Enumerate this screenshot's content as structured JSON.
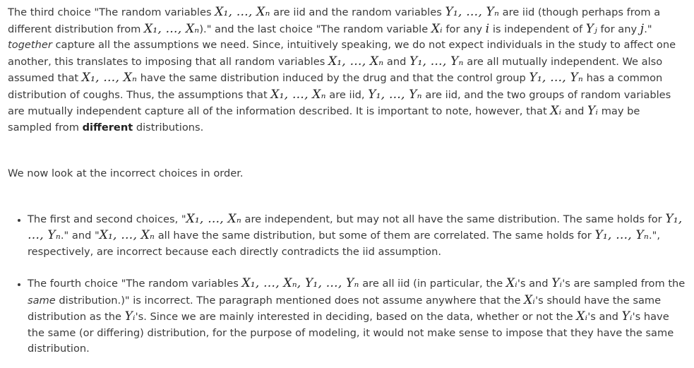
{
  "intro": {
    "p01": "The third choice \"The random variables ",
    "m01": "X₁, …, Xₙ",
    "p02": " are iid and the random variables ",
    "m02": "Y₁, …, Yₙ",
    "p03": " are iid (though perhaps from a different distribution from ",
    "m03": "X₁, …, Xₙ",
    "p04": ").\" and the last choice \"The random variable ",
    "m04": "Xᵢ",
    "p05": " for any ",
    "m05": "i",
    "p06": " is independent of ",
    "m06": "Yⱼ",
    "p07": " for any ",
    "m07": "j",
    "p08": ".\" ",
    "em01": "together",
    "p09": " capture all the assumptions we need. Since, intuitively speaking, we do not expect individuals in the study to affect one another, this translates to imposing that all random variables ",
    "m08": "X₁, …, Xₙ",
    "p10": " and ",
    "m09": "Y₁, …, Yₙ",
    "p11": " are all mutually independent. We also assumed that ",
    "m10": "X₁, …, Xₙ",
    "p12": " have the same distribution induced by the drug and that the control group ",
    "m11": "Y₁, …, Yₙ",
    "p13": " has a common distribution of coughs. Thus, the assumptions that ",
    "m12": "X₁, …, Xₙ",
    "p14": " are iid, ",
    "m13": "Y₁, …, Yₙ",
    "p15": " are iid, and the two groups of random variables are mutually independent capture all of the information described. It is important to note, however, that ",
    "m14": "Xᵢ",
    "p16": " and ",
    "m15": "Yᵢ",
    "p17": " may be sampled from ",
    "strong01": "different",
    "p18": " distributions."
  },
  "order_text": "We now look at the incorrect choices in order.",
  "bullet1": {
    "p01": "The first and second choices, \"",
    "m01": "X₁, …, Xₙ",
    "p02": " are independent, but may not all have the same distribution. The same holds for ",
    "m02": "Y₁, …, Yₙ",
    "p03": ".\" and \"",
    "m03": "X₁, …, Xₙ",
    "p04": " all have the same distribution, but some of them are correlated. The same holds for ",
    "m04": "Y₁, …, Yₙ",
    "p05": ".\", respectively, are incorrect because each directly contradicts the iid assumption."
  },
  "bullet2": {
    "p01": "The fourth choice \"The random variables ",
    "m01": "X₁, …, Xₙ, Y₁, …, Yₙ",
    "p02": " are all iid (in particular, the ",
    "m02": "Xᵢ",
    "p03": "'s and ",
    "m03": "Yᵢ",
    "p04": "'s are sampled from the ",
    "em01": "same",
    "p05": " distribution.)\" is incorrect. The paragraph mentioned does not assume anywhere that the ",
    "m04": "Xᵢ",
    "p06": "'s should have the same distribution as the ",
    "m05": "Yᵢ",
    "p07": "'s. Since we are mainly interested in deciding, based on the data, whether or not the ",
    "m06": "Xᵢ",
    "p08": "'s and ",
    "m07": "Yᵢ",
    "p09": "'s have the same (or differing) distribution, for the purpose of modeling, it would not make sense to impose that they have the same distribution."
  }
}
